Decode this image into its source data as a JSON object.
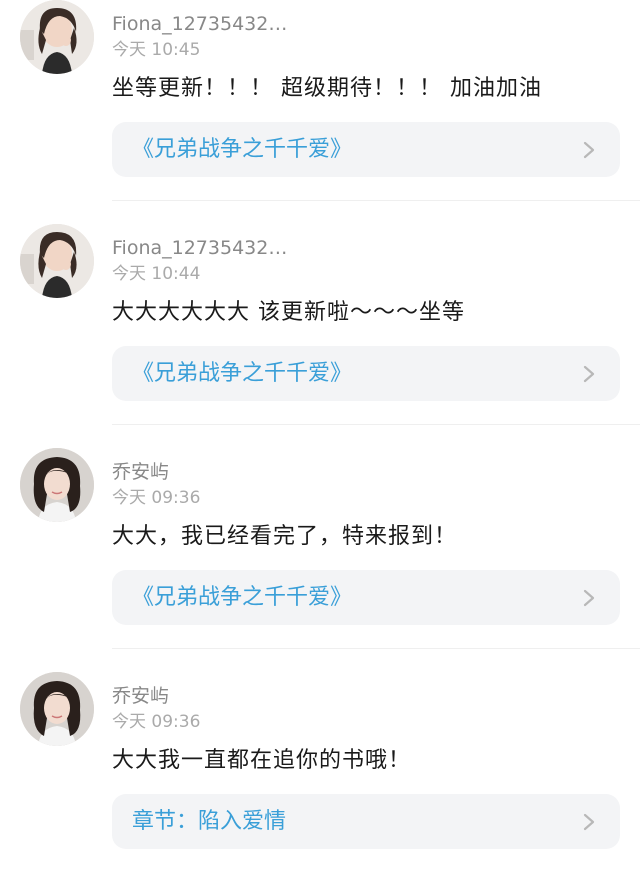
{
  "colors": {
    "link": "#3a9fd8",
    "username": "#888888",
    "timestamp": "#aaaaaa",
    "text": "#1a1a1a",
    "card_bg": "#f3f4f6"
  },
  "comments": [
    {
      "username": "Fiona_12735432…",
      "time": "今天 10:45",
      "text": "坐等更新！！！ 超级期待！！！ 加油加油",
      "link": "《兄弟战争之千千爱》",
      "avatar": "avatar-fiona-icon"
    },
    {
      "username": "Fiona_12735432…",
      "time": "今天 10:44",
      "text": "大大大大大大 该更新啦～～～坐等",
      "link": "《兄弟战争之千千爱》",
      "avatar": "avatar-fiona-icon"
    },
    {
      "username": "乔安屿",
      "time": "今天 09:36",
      "text": "大大，我已经看完了，特来报到！",
      "link": "《兄弟战争之千千爱》",
      "avatar": "avatar-qiaoanyu-icon"
    },
    {
      "username": "乔安屿",
      "time": "今天 09:36",
      "text": "大大我一直都在追你的书哦！",
      "link": "章节：陷入爱情",
      "avatar": "avatar-qiaoanyu-icon"
    }
  ]
}
